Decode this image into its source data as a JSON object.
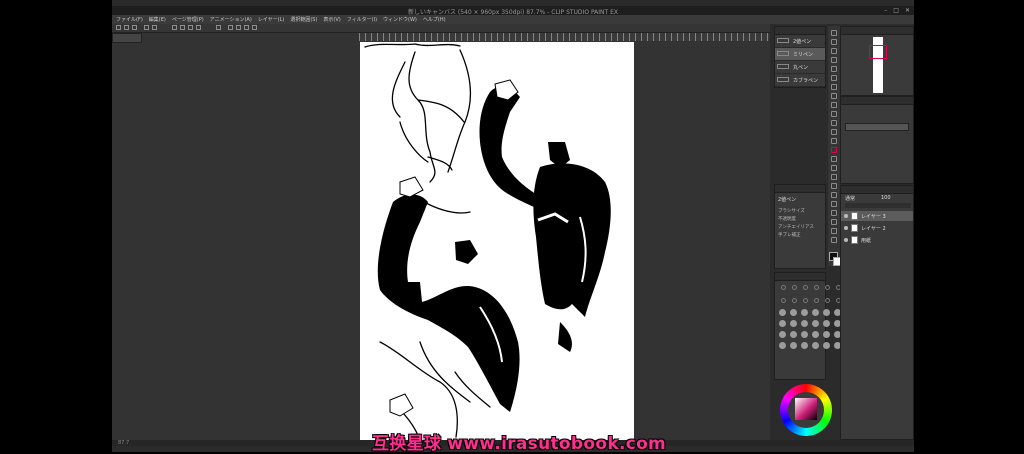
{
  "window": {
    "title": "新しいキャンバス (540 × 960px 350dpi) 87.7% - CLIP STUDIO PAINT EX"
  },
  "menubar": {
    "items": [
      "ファイル(F)",
      "編集(E)",
      "ページ管理(P)",
      "アニメーション(A)",
      "レイヤー(L)",
      "選択範囲(S)",
      "表示(V)",
      "フィルター(I)",
      "ウィンドウ(W)",
      "ヘルプ(H)"
    ]
  },
  "status": {
    "zoom": "87.7"
  },
  "subtool": {
    "items": [
      "2値ペン",
      "ミリペン",
      "丸ペン",
      "カブラペン"
    ],
    "selected_index": 1
  },
  "tool_property": {
    "tool_name": "2値ペン",
    "rows": [
      "ブラシサイズ",
      "不透明度",
      "アンチエイリアス",
      "手ブレ補正"
    ]
  },
  "layers": {
    "blend_mode": "通常",
    "opacity": "100",
    "items": [
      {
        "name": "レイヤー 3",
        "selected": true
      },
      {
        "name": "レイヤー 2",
        "selected": false
      },
      {
        "name": "用紙",
        "selected": false
      }
    ]
  },
  "colors": {
    "accent": "#e00050",
    "watermark": "#ff2e8f",
    "panel_bg": "#3a3a3a",
    "canvas_bg": "#333333"
  },
  "watermark": {
    "text": "互换星球 www.irasutobook.com"
  }
}
